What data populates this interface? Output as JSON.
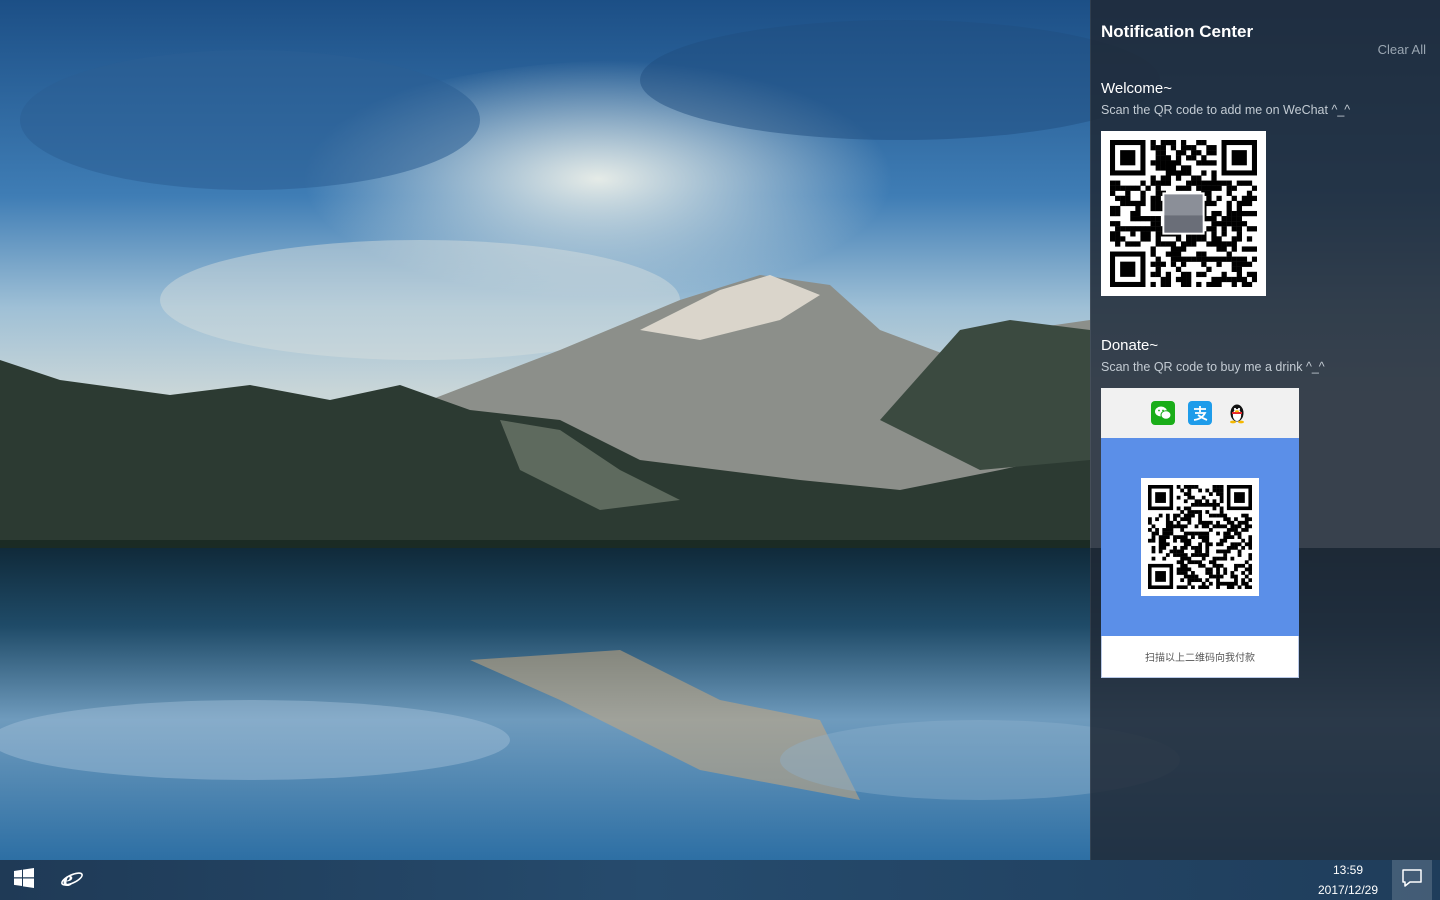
{
  "notification_center": {
    "title": "Notification Center",
    "clear_all": "Clear All",
    "notifications": [
      {
        "title": "Welcome~",
        "message": "Scan the QR code to add me on WeChat ^_^",
        "image": "wechat-qr-code"
      },
      {
        "title": "Donate~",
        "message": "Scan the QR code to buy me a drink ^_^",
        "image": "payment-qr-card",
        "payment_icons": [
          "wechat-pay-icon",
          "alipay-icon",
          "qq-penguin-icon"
        ],
        "caption": "扫描以上二维码向我付款"
      }
    ]
  },
  "taskbar": {
    "time": "13:59",
    "date": "2017/12/29",
    "icons": [
      "windows-start-icon",
      "internet-explorer-icon",
      "action-center-icon"
    ]
  },
  "colors": {
    "panel_bg": "#1f2935",
    "taskbar_bg": "#244665",
    "payment_blue": "#5b8fe8",
    "wechat_green": "#1aad19",
    "alipay_blue": "#1e9cea"
  }
}
